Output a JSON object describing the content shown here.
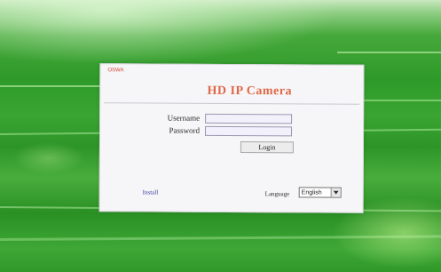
{
  "login": {
    "corner_label": "OSWA",
    "title": "HD IP Camera",
    "username_label": "Username",
    "password_label": "Password",
    "username_value": "",
    "password_value": "",
    "login_button": "Login",
    "install_link": "Install",
    "language_label": "Language",
    "language_selected": "English"
  },
  "colors": {
    "title": "#e06848",
    "corner_label": "#d33a2a",
    "install_link": "#3a3aa0",
    "wallpaper": "#2f9b2c",
    "panel": "#f6f6f8"
  }
}
